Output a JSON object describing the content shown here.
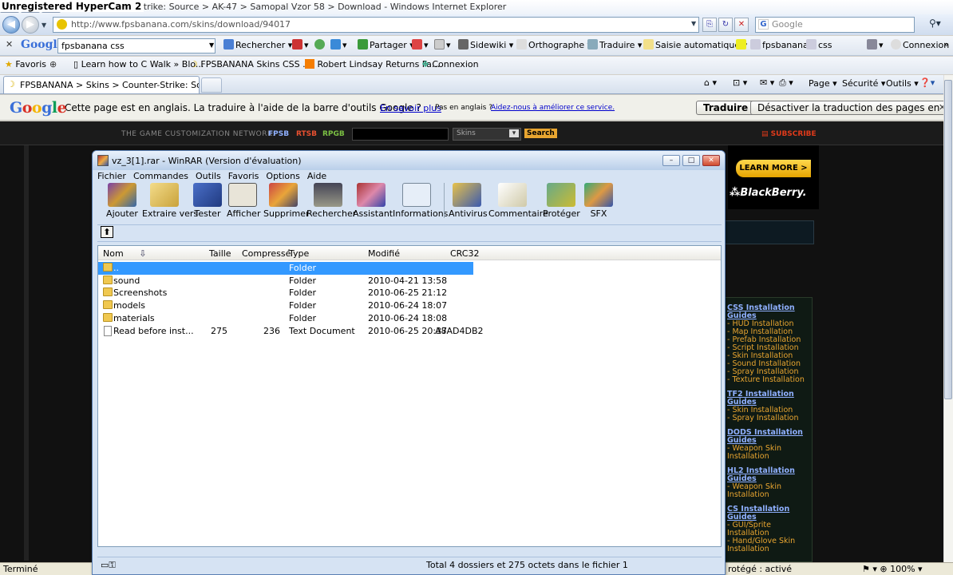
{
  "watermark": "Unregistered HyperCam 2",
  "ie": {
    "window_title": "Counter-Strike: Source > AK-47 > Samopal Vzor 58 > Download - Windows Internet Explorer",
    "title_shown": "unter-Strike: Source > AK-47 > Samopal Vzor 58 > Download - Windows Internet Explorer",
    "address": "http://www.fpsbanana.com/skins/download/94017",
    "search_placeholder": "Google",
    "window_buttons": {
      "minimize": "–",
      "maximize": "□",
      "close": "✕"
    },
    "google_toolbar": {
      "close": "✕",
      "logo": "Google",
      "query": "fpsbanana css",
      "items": [
        "Rechercher",
        "Partager",
        "Sidewiki",
        "Orthographe",
        "Traduire",
        "Saisie automatique",
        "fpsbanana",
        "css",
        "Connexion"
      ]
    },
    "favorites": {
      "label": "Favoris",
      "links": [
        "Learn how to C Walk » Blo...",
        "FPSBANANA  Skins  CSS  ...",
        "Robert Lindsay Returns Fa...",
        "Connexion"
      ]
    },
    "tab_title": "FPSBANANA > Skins > Counter-Strike: Source > ...",
    "command_bar": [
      "Page",
      "Sécurité",
      "Outils"
    ],
    "translate_bar": {
      "logo": "Google",
      "message": "Cette page est en anglais. La traduire à l'aide de la barre d'outils Google ?",
      "learn_more": "En savoir plus",
      "not_english": "Pas en anglais ?",
      "help": "Aidez-nous à améliorer ce service.",
      "translate_btn": "Traduire",
      "disable_btn": "Désactiver la traduction des pages en anglais",
      "close": "✕"
    },
    "status": {
      "left": "Terminé",
      "zone": "rotégé : activé",
      "zoom": "100%"
    }
  },
  "webpage": {
    "network_label": "THE GAME CUSTOMIZATION NETWORK:",
    "network_links": [
      "FPSB",
      "RTSB",
      "RPGB"
    ],
    "skins_select": "Skins",
    "search_btn": "Search",
    "subscribe": "SUBSCRIBE",
    "ad_learn_more": "LEARN MORE >",
    "ad_brand": "BlackBerry.",
    "guides": [
      {
        "title": "CSS Installation Guides",
        "links": [
          "HUD Installation",
          "Map Installation",
          "Prefab Installation",
          "Script Installation",
          "Skin Installation",
          "Sound Installation",
          "Spray Installation",
          "Texture Installation"
        ]
      },
      {
        "title": "TF2 Installation Guides",
        "links": [
          "Skin Installation",
          "Spray Installation"
        ]
      },
      {
        "title": "DODS Installation Guides",
        "links": [
          "Weapon Skin Installation"
        ]
      },
      {
        "title": "HL2 Installation Guides",
        "links": [
          "Weapon Skin Installation"
        ]
      },
      {
        "title": "CS Installation Guides",
        "links": [
          "GUI/Sprite Installation",
          "Hand/Glove Skin Installation"
        ]
      }
    ]
  },
  "winrar": {
    "title": "vz_3[1].rar - WinRAR (Version d'évaluation)",
    "window_buttons": {
      "minimize": "–",
      "maximize": "□",
      "close": "✕"
    },
    "menu": [
      "Fichier",
      "Commandes",
      "Outils",
      "Favoris",
      "Options",
      "Aide"
    ],
    "tools": [
      "Ajouter",
      "Extraire vers",
      "Tester",
      "Afficher",
      "Supprimer",
      "Rechercher",
      "Assistant",
      "Informations",
      "Antivirus",
      "Commentaire",
      "Protéger",
      "SFX"
    ],
    "up_icon": "⬆",
    "columns": [
      "Nom",
      "Taille",
      "Compressé",
      "Type",
      "Modifié",
      "CRC32"
    ],
    "sort_arrow": "⇩",
    "files": [
      {
        "name": "..",
        "size": "",
        "packed": "",
        "type": "Folder",
        "modified": "",
        "crc": "",
        "kind": "up"
      },
      {
        "name": "sound",
        "size": "",
        "packed": "",
        "type": "Folder",
        "modified": "2010-04-21 13:58",
        "crc": "",
        "kind": "folder"
      },
      {
        "name": "Screenshots",
        "size": "",
        "packed": "",
        "type": "Folder",
        "modified": "2010-06-25 21:12",
        "crc": "",
        "kind": "folder"
      },
      {
        "name": "models",
        "size": "",
        "packed": "",
        "type": "Folder",
        "modified": "2010-06-24 18:07",
        "crc": "",
        "kind": "folder"
      },
      {
        "name": "materials",
        "size": "",
        "packed": "",
        "type": "Folder",
        "modified": "2010-06-24 18:08",
        "crc": "",
        "kind": "folder"
      },
      {
        "name": "Read before inst...",
        "size": "275",
        "packed": "236",
        "type": "Text Document",
        "modified": "2010-06-25 20:37",
        "crc": "A8AD4DB2",
        "kind": "doc"
      }
    ],
    "status": "Total 4 dossiers et 275 octets dans le fichier 1"
  },
  "colors": {
    "selection": "#3399ff",
    "link_blue": "#8fb0ff",
    "guide_orange": "#e8a530",
    "subscribe_red": "#e03a1a"
  }
}
